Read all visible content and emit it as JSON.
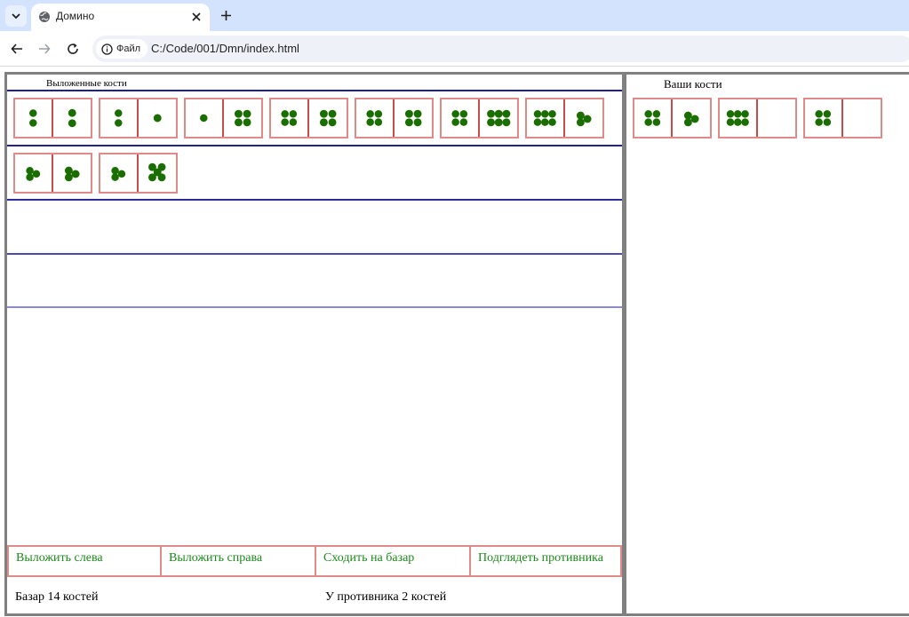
{
  "browser": {
    "tab_title": "Домино",
    "site_chip": "Файл",
    "url": "C:/Code/001/Dmn/index.html"
  },
  "board": {
    "title": "Выложенные кости",
    "rows": [
      [
        [
          2,
          2
        ],
        [
          2,
          1
        ],
        [
          1,
          4
        ],
        [
          4,
          4
        ],
        [
          4,
          4
        ],
        [
          4,
          6
        ],
        [
          6,
          3
        ]
      ],
      [
        [
          3,
          3
        ],
        [
          3,
          5
        ]
      ],
      [],
      []
    ]
  },
  "hand": {
    "title": "Ваши кости",
    "tiles": [
      [
        4,
        3
      ],
      [
        6,
        0
      ],
      [
        4,
        0
      ]
    ]
  },
  "actions": {
    "play_left": "Выложить слева",
    "play_right": "Выложить справа",
    "go_bazaar": "Сходить на базар",
    "peek_opponent": "Подглядеть противника"
  },
  "status": {
    "bazaar": "Базар 14 костей",
    "opponent": "У противника 2 костей"
  },
  "colors": {
    "pip": "#1a6e00",
    "tile_border": "#e08a8a",
    "tile_divider": "#c94c4c",
    "row_line": "#1f1f8f",
    "panel_border": "#808080",
    "button_text": "#1b8a1b"
  }
}
